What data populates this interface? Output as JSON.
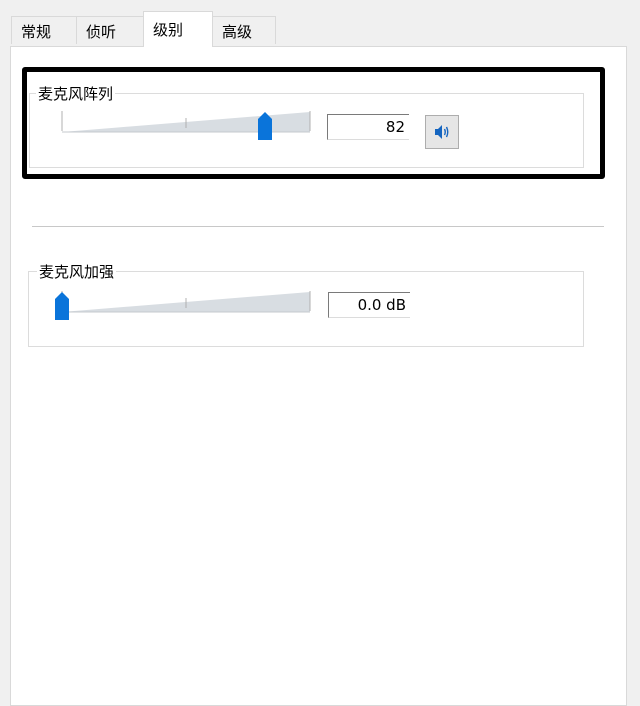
{
  "tabs": [
    {
      "label": "常规",
      "active": false
    },
    {
      "label": "侦听",
      "active": false
    },
    {
      "label": "级别",
      "active": true
    },
    {
      "label": "高级",
      "active": false
    }
  ],
  "mic_array": {
    "title": "麦克风阵列",
    "level": 82,
    "value_text": "82",
    "mute_button_icon": "speaker-icon"
  },
  "mic_boost": {
    "title": "麦克风加强",
    "level": 0,
    "value_text": "0.0 dB"
  },
  "colors": {
    "accent": "#0a74da",
    "track": "#d8dde2"
  }
}
